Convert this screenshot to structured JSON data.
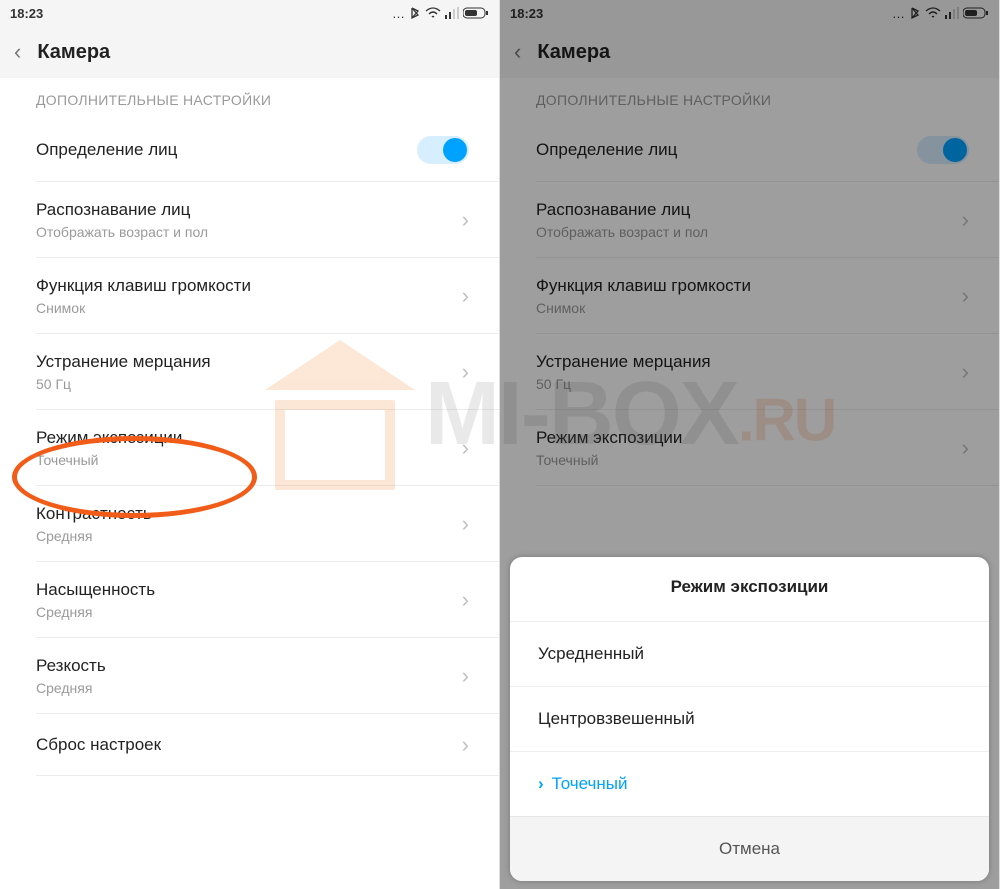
{
  "status": {
    "time": "18:23",
    "dots": "…",
    "bt": "bluetooth-icon",
    "wifi": "wifi-icon",
    "signal": "signal-icon",
    "battery": "battery-icon"
  },
  "header": {
    "title": "Камера",
    "back": "‹"
  },
  "section_title": "ДОПОЛНИТЕЛЬНЫЕ НАСТРОЙКИ",
  "rows": {
    "face_detect": {
      "title": "Определение лиц"
    },
    "face_recog": {
      "title": "Распознавание лиц",
      "sub": "Отображать возраст и пол"
    },
    "volume_keys": {
      "title": "Функция клавиш громкости",
      "sub": "Снимок"
    },
    "antiflicker": {
      "title": "Устранение мерцания",
      "sub": "50 Гц"
    },
    "exposure": {
      "title": "Режим экспозиции",
      "sub": "Точечный"
    },
    "contrast": {
      "title": "Контрастность",
      "sub": "Средняя"
    },
    "saturation": {
      "title": "Насыщенность",
      "sub": "Средняя"
    },
    "sharpness": {
      "title": "Резкость",
      "sub": "Средняя"
    },
    "reset": {
      "title": "Сброс настроек"
    }
  },
  "sheet": {
    "title": "Режим экспозиции",
    "opt1": "Усредненный",
    "opt2": "Центровзвешенный",
    "opt3": "Точечный",
    "cancel": "Отмена"
  },
  "watermark": {
    "text_main": "MI-BOX",
    "text_suffix": ".RU"
  }
}
